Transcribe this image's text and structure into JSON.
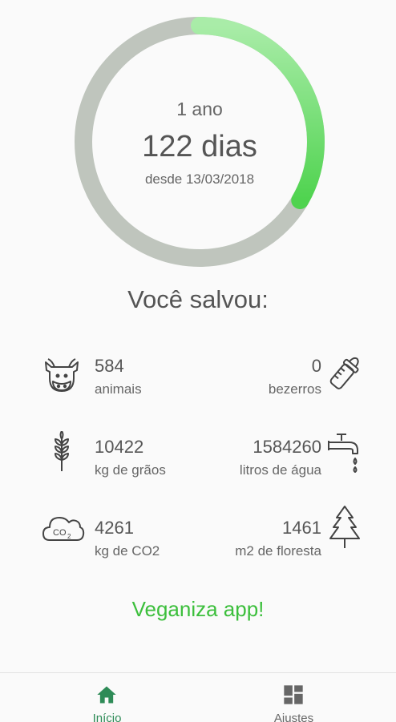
{
  "counter": {
    "years": "1 ano",
    "days": "122 dias",
    "since": "desde 13/03/2018",
    "progress": 0.334
  },
  "saved_title": "Você salvou:",
  "stats": {
    "animals": {
      "value": "584",
      "label": "animais",
      "icon": "cow-icon"
    },
    "calves": {
      "value": "0",
      "label": "bezerros",
      "icon": "baby-bottle-icon"
    },
    "grains": {
      "value": "10422",
      "label": "kg de grãos",
      "icon": "wheat-icon"
    },
    "water": {
      "value": "1584260",
      "label": "litros de água",
      "icon": "faucet-icon"
    },
    "co2": {
      "value": "4261",
      "label": "kg de CO2",
      "icon": "co2-cloud-icon"
    },
    "forest": {
      "value": "1461",
      "label": "m2 de floresta",
      "icon": "pine-tree-icon"
    }
  },
  "cta": "Veganiza app!",
  "nav": {
    "home_label": "Início",
    "settings_label": "Ajustes"
  },
  "colors": {
    "ring_track": "#bfc5bd",
    "ring_start": "#a9eca8",
    "ring_end": "#4fd34f",
    "accent": "#3cbf3c",
    "nav_active": "#2e8b57"
  }
}
